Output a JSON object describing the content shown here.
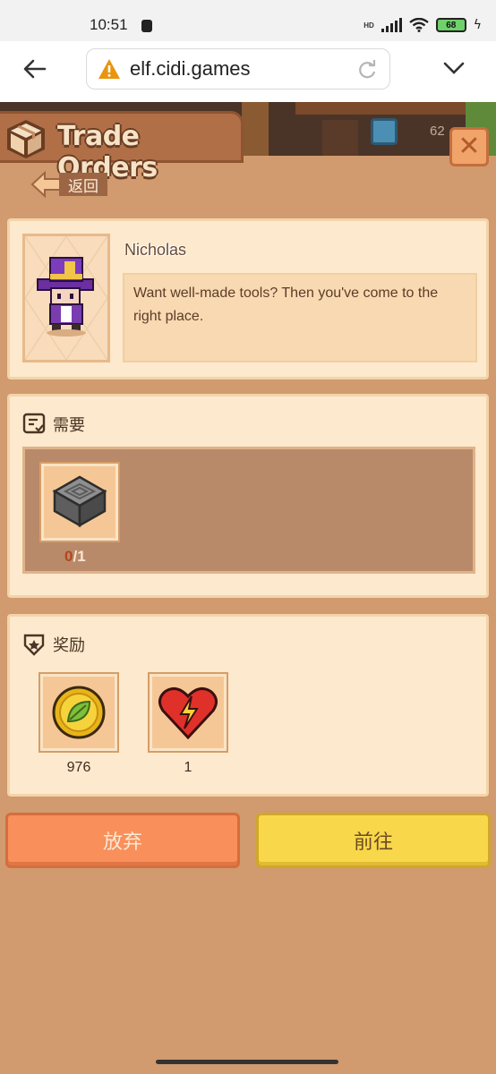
{
  "status_bar": {
    "time": "10:51",
    "battery": "68",
    "network": "HD"
  },
  "browser": {
    "url": "elf.cidi.games"
  },
  "hud": {
    "coin_count": "62"
  },
  "header": {
    "title": "Trade Orders",
    "back_label": "返回"
  },
  "npc": {
    "name": "Nicholas",
    "dialog": "Want well-made tools? Then you've come to the right place."
  },
  "need_section": {
    "label": "需要",
    "items": [
      {
        "icon": "stone-block-icon",
        "have": "0",
        "required": "/1"
      }
    ]
  },
  "reward_section": {
    "label": "奖励",
    "items": [
      {
        "icon": "leaf-coin-icon",
        "value": "976"
      },
      {
        "icon": "energy-heart-icon",
        "value": "1"
      }
    ]
  },
  "actions": {
    "abandon_label": "放弃",
    "goto_label": "前往"
  },
  "colors": {
    "accent_orange": "#f98f5a",
    "accent_yellow": "#f9d74a",
    "panel_bg": "#fde9cd",
    "page_bg": "#d19a6f"
  }
}
